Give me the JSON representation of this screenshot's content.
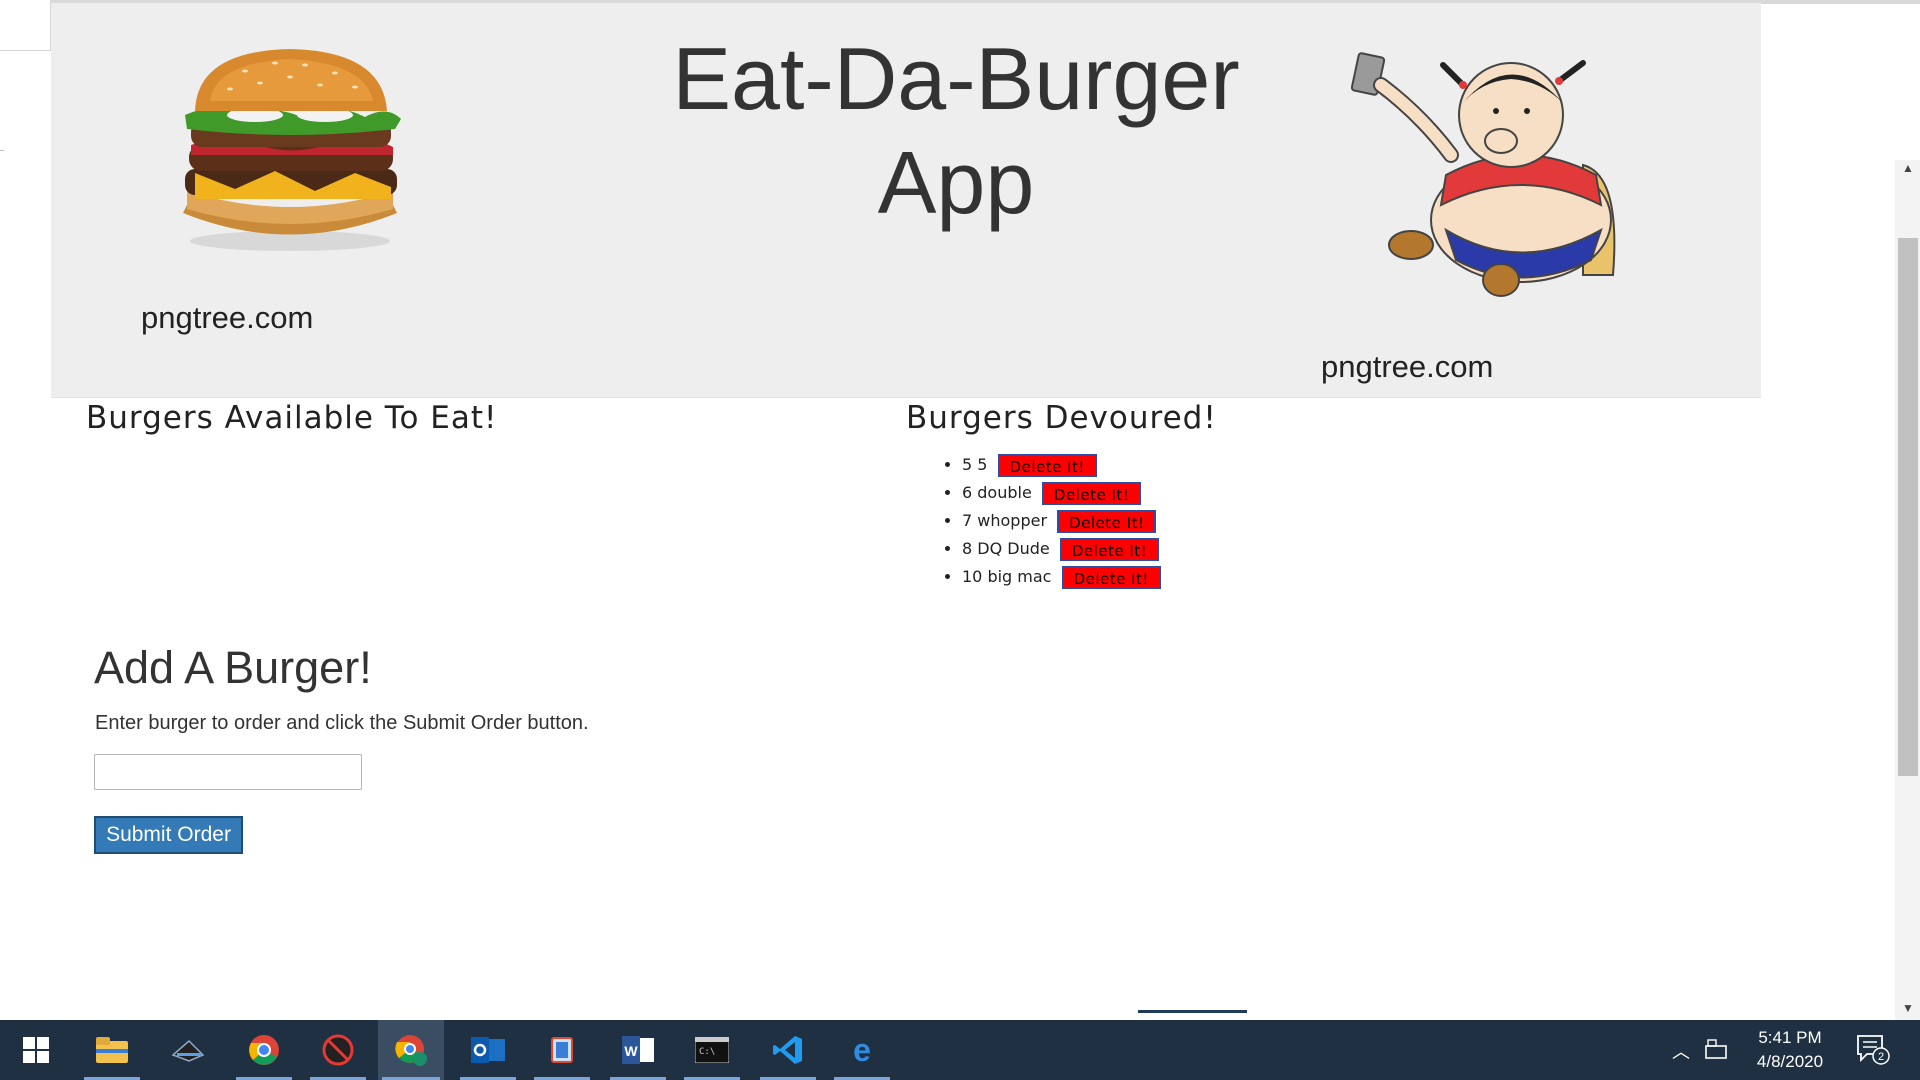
{
  "header": {
    "title_line1": "Eat-Da-Burger",
    "title_line2": "App",
    "credit_left": "pngtree.com",
    "credit_right": "pngtree.com"
  },
  "available": {
    "heading": "Burgers Available To Eat!",
    "items": []
  },
  "devoured": {
    "heading": "Burgers Devoured!",
    "items": [
      {
        "label": "5 5",
        "button": "Delete It!"
      },
      {
        "label": "6 double",
        "button": "Delete It!"
      },
      {
        "label": "7 whopper",
        "button": "Delete It!"
      },
      {
        "label": "8 DQ Dude",
        "button": "Delete It!"
      },
      {
        "label": "10 big mac",
        "button": "Delete It!"
      }
    ]
  },
  "form": {
    "heading": "Add A Burger!",
    "instructions": "Enter burger to order and click the Submit Order button.",
    "input_value": "",
    "submit_label": "Submit Order"
  },
  "taskbar": {
    "time": "5:41 PM",
    "date": "4/8/2020",
    "notification_count": "2",
    "apps": [
      "windows-start",
      "file-explorer",
      "scanner",
      "chrome",
      "blocked-app",
      "chrome-profile",
      "outlook",
      "teams-like",
      "word",
      "terminal",
      "vscode",
      "edge"
    ]
  },
  "colors": {
    "jumbotron_bg": "#eeeeee",
    "delete_button": "#ff0000",
    "submit_button": "#337ab7",
    "taskbar_bg": "#1f3043"
  }
}
